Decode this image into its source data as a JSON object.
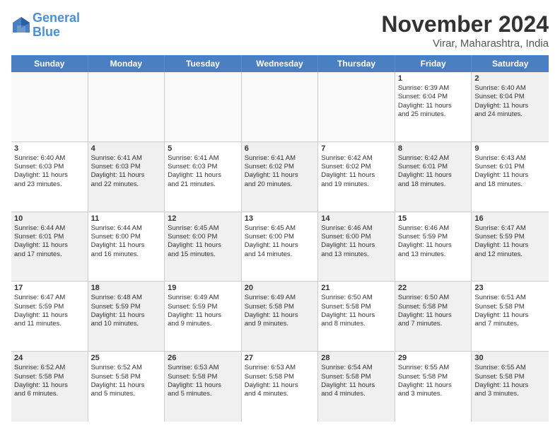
{
  "header": {
    "logo_line1": "General",
    "logo_line2": "Blue",
    "month": "November 2024",
    "location": "Virar, Maharashtra, India"
  },
  "weekdays": [
    "Sunday",
    "Monday",
    "Tuesday",
    "Wednesday",
    "Thursday",
    "Friday",
    "Saturday"
  ],
  "weeks": [
    [
      {
        "day": "",
        "info": "",
        "empty": true
      },
      {
        "day": "",
        "info": "",
        "empty": true
      },
      {
        "day": "",
        "info": "",
        "empty": true
      },
      {
        "day": "",
        "info": "",
        "empty": true
      },
      {
        "day": "",
        "info": "",
        "empty": true
      },
      {
        "day": "1",
        "info": "Sunrise: 6:39 AM\nSunset: 6:04 PM\nDaylight: 11 hours\nand 25 minutes.",
        "empty": false
      },
      {
        "day": "2",
        "info": "Sunrise: 6:40 AM\nSunset: 6:04 PM\nDaylight: 11 hours\nand 24 minutes.",
        "empty": false,
        "shaded": true
      }
    ],
    [
      {
        "day": "3",
        "info": "Sunrise: 6:40 AM\nSunset: 6:03 PM\nDaylight: 11 hours\nand 23 minutes.",
        "empty": false
      },
      {
        "day": "4",
        "info": "Sunrise: 6:41 AM\nSunset: 6:03 PM\nDaylight: 11 hours\nand 22 minutes.",
        "empty": false,
        "shaded": true
      },
      {
        "day": "5",
        "info": "Sunrise: 6:41 AM\nSunset: 6:03 PM\nDaylight: 11 hours\nand 21 minutes.",
        "empty": false
      },
      {
        "day": "6",
        "info": "Sunrise: 6:41 AM\nSunset: 6:02 PM\nDaylight: 11 hours\nand 20 minutes.",
        "empty": false,
        "shaded": true
      },
      {
        "day": "7",
        "info": "Sunrise: 6:42 AM\nSunset: 6:02 PM\nDaylight: 11 hours\nand 19 minutes.",
        "empty": false
      },
      {
        "day": "8",
        "info": "Sunrise: 6:42 AM\nSunset: 6:01 PM\nDaylight: 11 hours\nand 18 minutes.",
        "empty": false,
        "shaded": true
      },
      {
        "day": "9",
        "info": "Sunrise: 6:43 AM\nSunset: 6:01 PM\nDaylight: 11 hours\nand 18 minutes.",
        "empty": false
      }
    ],
    [
      {
        "day": "10",
        "info": "Sunrise: 6:44 AM\nSunset: 6:01 PM\nDaylight: 11 hours\nand 17 minutes.",
        "empty": false,
        "shaded": true
      },
      {
        "day": "11",
        "info": "Sunrise: 6:44 AM\nSunset: 6:00 PM\nDaylight: 11 hours\nand 16 minutes.",
        "empty": false
      },
      {
        "day": "12",
        "info": "Sunrise: 6:45 AM\nSunset: 6:00 PM\nDaylight: 11 hours\nand 15 minutes.",
        "empty": false,
        "shaded": true
      },
      {
        "day": "13",
        "info": "Sunrise: 6:45 AM\nSunset: 6:00 PM\nDaylight: 11 hours\nand 14 minutes.",
        "empty": false
      },
      {
        "day": "14",
        "info": "Sunrise: 6:46 AM\nSunset: 6:00 PM\nDaylight: 11 hours\nand 13 minutes.",
        "empty": false,
        "shaded": true
      },
      {
        "day": "15",
        "info": "Sunrise: 6:46 AM\nSunset: 5:59 PM\nDaylight: 11 hours\nand 13 minutes.",
        "empty": false
      },
      {
        "day": "16",
        "info": "Sunrise: 6:47 AM\nSunset: 5:59 PM\nDaylight: 11 hours\nand 12 minutes.",
        "empty": false,
        "shaded": true
      }
    ],
    [
      {
        "day": "17",
        "info": "Sunrise: 6:47 AM\nSunset: 5:59 PM\nDaylight: 11 hours\nand 11 minutes.",
        "empty": false
      },
      {
        "day": "18",
        "info": "Sunrise: 6:48 AM\nSunset: 5:59 PM\nDaylight: 11 hours\nand 10 minutes.",
        "empty": false,
        "shaded": true
      },
      {
        "day": "19",
        "info": "Sunrise: 6:49 AM\nSunset: 5:59 PM\nDaylight: 11 hours\nand 9 minutes.",
        "empty": false
      },
      {
        "day": "20",
        "info": "Sunrise: 6:49 AM\nSunset: 5:58 PM\nDaylight: 11 hours\nand 9 minutes.",
        "empty": false,
        "shaded": true
      },
      {
        "day": "21",
        "info": "Sunrise: 6:50 AM\nSunset: 5:58 PM\nDaylight: 11 hours\nand 8 minutes.",
        "empty": false
      },
      {
        "day": "22",
        "info": "Sunrise: 6:50 AM\nSunset: 5:58 PM\nDaylight: 11 hours\nand 7 minutes.",
        "empty": false,
        "shaded": true
      },
      {
        "day": "23",
        "info": "Sunrise: 6:51 AM\nSunset: 5:58 PM\nDaylight: 11 hours\nand 7 minutes.",
        "empty": false
      }
    ],
    [
      {
        "day": "24",
        "info": "Sunrise: 6:52 AM\nSunset: 5:58 PM\nDaylight: 11 hours\nand 6 minutes.",
        "empty": false,
        "shaded": true
      },
      {
        "day": "25",
        "info": "Sunrise: 6:52 AM\nSunset: 5:58 PM\nDaylight: 11 hours\nand 5 minutes.",
        "empty": false
      },
      {
        "day": "26",
        "info": "Sunrise: 6:53 AM\nSunset: 5:58 PM\nDaylight: 11 hours\nand 5 minutes.",
        "empty": false,
        "shaded": true
      },
      {
        "day": "27",
        "info": "Sunrise: 6:53 AM\nSunset: 5:58 PM\nDaylight: 11 hours\nand 4 minutes.",
        "empty": false
      },
      {
        "day": "28",
        "info": "Sunrise: 6:54 AM\nSunset: 5:58 PM\nDaylight: 11 hours\nand 4 minutes.",
        "empty": false,
        "shaded": true
      },
      {
        "day": "29",
        "info": "Sunrise: 6:55 AM\nSunset: 5:58 PM\nDaylight: 11 hours\nand 3 minutes.",
        "empty": false
      },
      {
        "day": "30",
        "info": "Sunrise: 6:55 AM\nSunset: 5:58 PM\nDaylight: 11 hours\nand 3 minutes.",
        "empty": false,
        "shaded": true
      }
    ]
  ]
}
